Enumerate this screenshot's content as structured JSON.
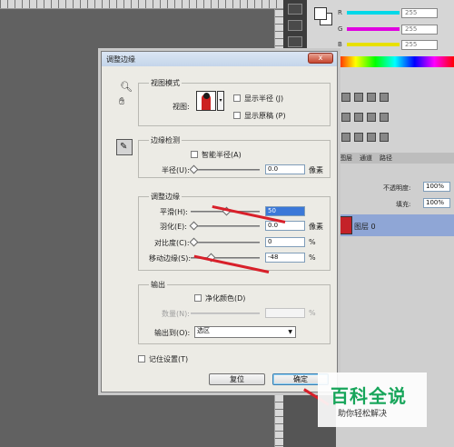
{
  "color_panel": {
    "channels": [
      {
        "label": "R",
        "value": "255",
        "color": "#00d8e8"
      },
      {
        "label": "G",
        "value": "255",
        "color": "#e000e0"
      },
      {
        "label": "B",
        "value": "255",
        "color": "#e8e000"
      }
    ]
  },
  "layers_panel": {
    "tabs": [
      "图层",
      "通道",
      "路径"
    ],
    "opacity_label": "不透明度:",
    "opacity_value": "100%",
    "fill_label": "填充:",
    "fill_value": "100%",
    "layer_name": "图层 0"
  },
  "dialog": {
    "title": "调整边缘",
    "close_label": "x",
    "view_mode": {
      "legend": "视图模式",
      "view_label": "视图:",
      "show_radius": "显示半径 (J)",
      "show_original": "显示原稿 (P)"
    },
    "edge_detection": {
      "legend": "边缘检测",
      "smart_radius": "智能半径(A)",
      "radius_label": "半径(U):",
      "radius_value": "0.0",
      "radius_unit": "像素"
    },
    "adjust_edge": {
      "legend": "调整边缘",
      "rows": [
        {
          "label": "平滑(H):",
          "value": "50",
          "unit": "",
          "level": 0.5
        },
        {
          "label": "羽化(E):",
          "value": "0.0",
          "unit": "像素",
          "level": 0.0
        },
        {
          "label": "对比度(C):",
          "value": "0",
          "unit": "%",
          "level": 0.0
        },
        {
          "label": "移动边缘(S):",
          "value": "-48",
          "unit": "%",
          "level": 0.26
        }
      ]
    },
    "output": {
      "legend": "输出",
      "decontaminate": "净化颜色(D)",
      "amount_label": "数量(N):",
      "amount_unit": "%",
      "output_to_label": "输出到(O):",
      "output_to_value": "选区"
    },
    "remember": "记住设置(T)",
    "reset_label": "复位",
    "ok_label": "确定"
  },
  "watermark": {
    "main": "百科全说",
    "sub": "助你轻松解决"
  }
}
